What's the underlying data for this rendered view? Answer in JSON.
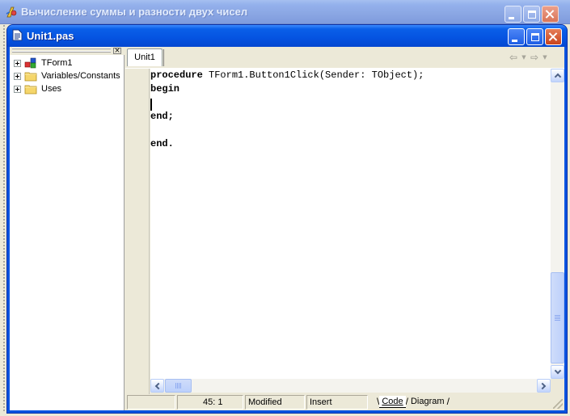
{
  "outer_window": {
    "title": "Вычисление суммы и разности двух чисел"
  },
  "editor_window": {
    "title": "Unit1.pas"
  },
  "explorer": {
    "close_glyph": "×",
    "items": [
      {
        "label": "TForm1",
        "icon": "class-icon"
      },
      {
        "label": "Variables/Constants",
        "icon": "folder-icon"
      },
      {
        "label": "Uses",
        "icon": "folder-icon"
      }
    ]
  },
  "tabs": [
    {
      "label": "Unit1",
      "active": true
    }
  ],
  "nav": {
    "back_icon": "arrow-left-icon",
    "forward_icon": "arrow-right-icon"
  },
  "code": {
    "lines": [
      {
        "keyword": "procedure",
        "rest": " TForm1.Button1Click(Sender: TObject);"
      },
      {
        "keyword": "begin",
        "rest": ""
      },
      {
        "keyword": "",
        "rest": ""
      },
      {
        "keyword": "end;",
        "rest": ""
      },
      {
        "keyword": "",
        "rest": ""
      },
      {
        "keyword": "end.",
        "rest": ""
      }
    ]
  },
  "status": {
    "position": "45:  1",
    "modified": "Modified",
    "mode": "Insert",
    "view_tabs": [
      "Code",
      "Diagram"
    ]
  },
  "colors": {
    "title_active": "#0553e1",
    "title_inactive": "#8aa6e3",
    "face": "#ece9d8",
    "editor_bg": "#ffffff"
  }
}
